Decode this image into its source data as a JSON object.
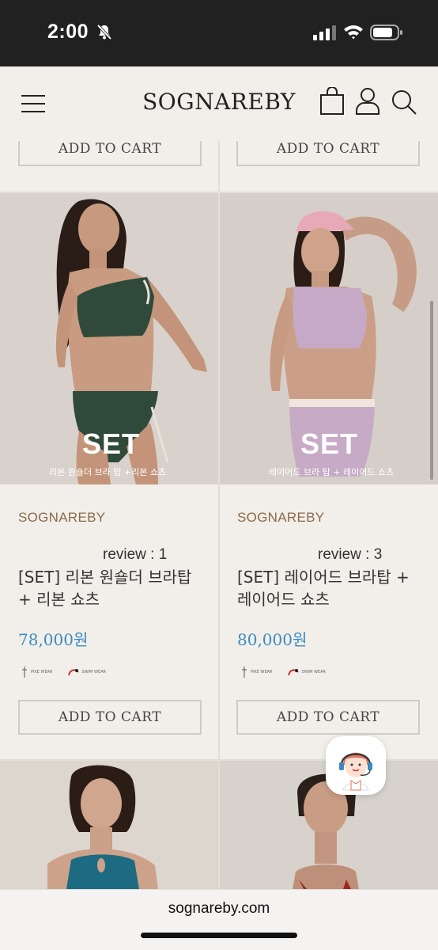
{
  "status": {
    "time": "2:00"
  },
  "header": {
    "brand": "SOGNAREBY"
  },
  "top_row": {
    "cart_left": "ADD TO CART",
    "cart_right": "ADD TO CART"
  },
  "products": [
    {
      "overlay_title": "SET",
      "overlay_subtitle": "리본 원숄더 브라 탑 +리본 쇼츠",
      "brand": "SOGNAREBY",
      "review": "review : 1",
      "name": "[SET] 리본 원숄더 브라탑 + 리본 쇼츠",
      "price": "78,000원",
      "cart_label": "ADD TO CART",
      "badge_a": "PIKE WEAR",
      "badge_b": "SWIM WEAR"
    },
    {
      "overlay_title": "SET",
      "overlay_subtitle": "레이어드 브라 탑 + 레이어드 쇼츠",
      "brand": "SOGNAREBY",
      "review": "review : 3",
      "name": "[SET] 레이어드 브라탑 + 레이어드 쇼츠",
      "price": "80,000원",
      "cart_label": "ADD TO CART",
      "badge_a": "PIKE WEAR",
      "badge_b": "SWIM WEAR"
    }
  ],
  "browser": {
    "url": "sognareby.com"
  },
  "colors": {
    "price": "#3a8cc0",
    "brand_text": "#8a6a4a",
    "background": "#f2efea"
  }
}
